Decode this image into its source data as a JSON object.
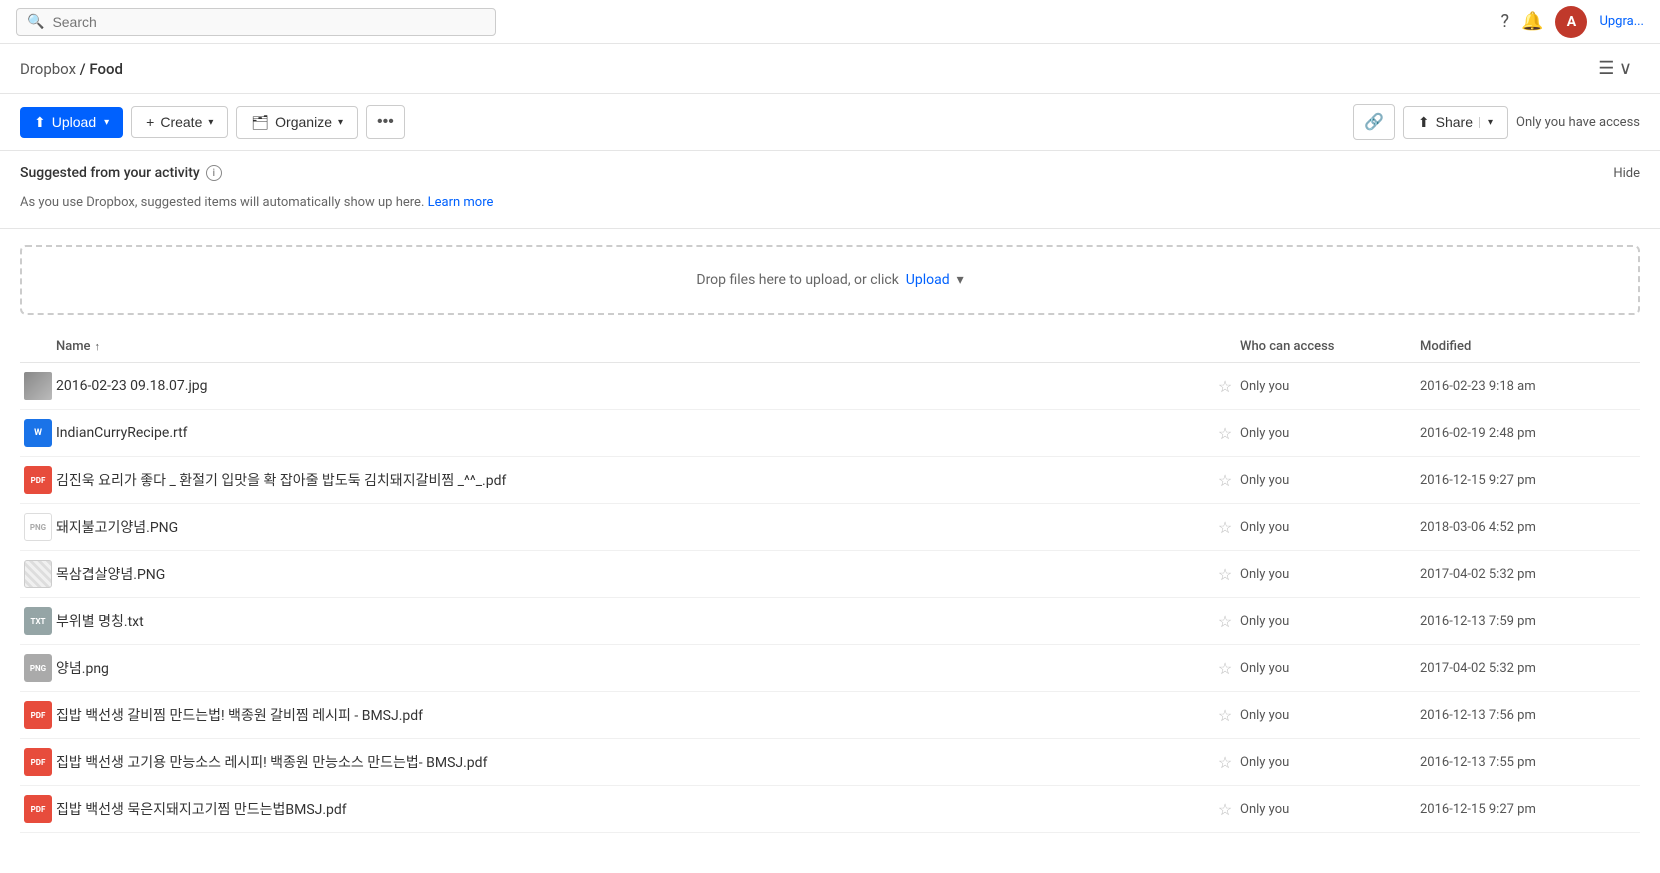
{
  "topbar": {
    "search_placeholder": "Search",
    "upgrade_label": "Upgra...",
    "avatar_initials": "A"
  },
  "header": {
    "breadcrumb_root": "Dropbox",
    "breadcrumb_separator": "/",
    "breadcrumb_current": "Food"
  },
  "toolbar": {
    "upload_label": "Upload",
    "create_label": "Create",
    "organize_label": "Organize",
    "more_label": "•••",
    "share_label": "Share",
    "access_text": "Only you have access"
  },
  "suggested": {
    "title": "Suggested from your activity",
    "body_text": "As you use Dropbox, suggested items will automatically show up here.",
    "learn_more": "Learn more",
    "hide_label": "Hide"
  },
  "dropzone": {
    "text": "Drop files here to upload, or click",
    "upload_label": "Upload"
  },
  "filelist": {
    "col_name": "Name",
    "col_sort_icon": "↑",
    "col_access": "Who can access",
    "col_modified": "Modified",
    "files": [
      {
        "name": "2016-02-23 09.18.07.jpg",
        "type": "jpg-thumb",
        "access": "Only you",
        "modified": "2016-02-23 9:18 am"
      },
      {
        "name": "IndianCurryRecipe.rtf",
        "type": "rtf",
        "access": "Only you",
        "modified": "2016-02-19 2:48 pm"
      },
      {
        "name": "김진욱 요리가 좋다 _ 환절기 입맛을 확 잡아줄 밥도둑 김치돼지갈비찜 _^^_.pdf",
        "type": "pdf",
        "access": "Only you",
        "modified": "2016-12-15 9:27 pm"
      },
      {
        "name": "돼지불고기양념.PNG",
        "type": "png-white",
        "access": "Only you",
        "modified": "2018-03-06 4:52 pm"
      },
      {
        "name": "목삼겹살양념.PNG",
        "type": "png-striped",
        "access": "Only you",
        "modified": "2017-04-02 5:32 pm"
      },
      {
        "name": "부위별 명칭.txt",
        "type": "txt",
        "access": "Only you",
        "modified": "2016-12-13 7:59 pm"
      },
      {
        "name": "양념.png",
        "type": "png-small",
        "access": "Only you",
        "modified": "2017-04-02 5:32 pm"
      },
      {
        "name": "집밥 백선생 갈비찜 만드는법! 백종원 갈비찜 레시피 - BMSJ.pdf",
        "type": "pdf",
        "access": "Only you",
        "modified": "2016-12-13 7:56 pm"
      },
      {
        "name": "집밥 백선생 고기용 만능소스 레시피! 백종원 만능소스 만드는법- BMSJ.pdf",
        "type": "pdf",
        "access": "Only you",
        "modified": "2016-12-13 7:55 pm"
      },
      {
        "name": "집밥 백선생 묵은지돼지고기찜 만드는법BMSJ.pdf",
        "type": "pdf",
        "access": "Only you",
        "modified": "2016-12-15 9:27 pm"
      }
    ]
  }
}
